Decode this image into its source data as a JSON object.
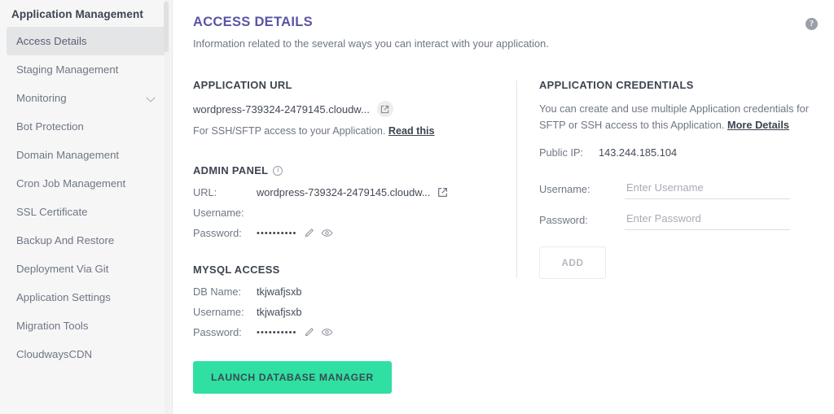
{
  "sidebar": {
    "title": "Application Management",
    "items": [
      {
        "label": "Access Details",
        "active": true,
        "chevron": false
      },
      {
        "label": "Staging Management",
        "active": false,
        "chevron": false
      },
      {
        "label": "Monitoring",
        "active": false,
        "chevron": true
      },
      {
        "label": "Bot Protection",
        "active": false,
        "chevron": false
      },
      {
        "label": "Domain Management",
        "active": false,
        "chevron": false
      },
      {
        "label": "Cron Job Management",
        "active": false,
        "chevron": false
      },
      {
        "label": "SSL Certificate",
        "active": false,
        "chevron": false
      },
      {
        "label": "Backup And Restore",
        "active": false,
        "chevron": false
      },
      {
        "label": "Deployment Via Git",
        "active": false,
        "chevron": false
      },
      {
        "label": "Application Settings",
        "active": false,
        "chevron": false
      },
      {
        "label": "Migration Tools",
        "active": false,
        "chevron": false
      },
      {
        "label": "CloudwaysCDN",
        "active": false,
        "chevron": false
      }
    ]
  },
  "header": {
    "title": "ACCESS DETAILS",
    "subtitle": "Information related to the several ways you can interact with your application.",
    "help_icon": "question-mark-circle-icon"
  },
  "application_url": {
    "heading": "APPLICATION URL",
    "url": "wordpress-739324-2479145.cloudw...",
    "open_icon": "external-link-icon",
    "note_text": "For SSH/SFTP access to your Application.",
    "note_link": "Read this"
  },
  "admin_panel": {
    "heading": "ADMIN PANEL",
    "info_icon": "info-circle-icon",
    "rows": [
      {
        "label": "URL:",
        "value": "wordpress-739324-2479145.cloudw...",
        "type": "url"
      },
      {
        "label": "Username:",
        "value": "",
        "type": "text"
      },
      {
        "label": "Password:",
        "value": "••••••••••",
        "type": "password"
      }
    ],
    "edit_icon": "pencil-icon",
    "reveal_icon": "eye-icon"
  },
  "mysql_access": {
    "heading": "MYSQL ACCESS",
    "rows": [
      {
        "label": "DB Name:",
        "value": "tkjwafjsxb",
        "type": "text"
      },
      {
        "label": "Username:",
        "value": "tkjwafjsxb",
        "type": "text"
      },
      {
        "label": "Password:",
        "value": "••••••••••",
        "type": "password"
      }
    ],
    "edit_icon": "pencil-icon",
    "reveal_icon": "eye-icon",
    "launch_button": "LAUNCH DATABASE MANAGER"
  },
  "application_credentials": {
    "heading": "APPLICATION CREDENTIALS",
    "description": "You can create and use multiple Application credentials for SFTP or SSH access to this Application.",
    "description_link": "More Details",
    "public_ip_label": "Public IP:",
    "public_ip_value": "143.244.185.104",
    "username_label": "Username:",
    "username_value": "",
    "username_placeholder": "Enter Username",
    "password_label": "Password:",
    "password_value": "",
    "password_placeholder": "Enter Password",
    "add_button": "ADD"
  },
  "colors": {
    "accent_title": "#5a54a4",
    "primary_button": "#2fe0a2",
    "sidebar_bg": "#f6f6f7",
    "active_item": "#e4e5e7",
    "muted_text": "#6f7683"
  }
}
